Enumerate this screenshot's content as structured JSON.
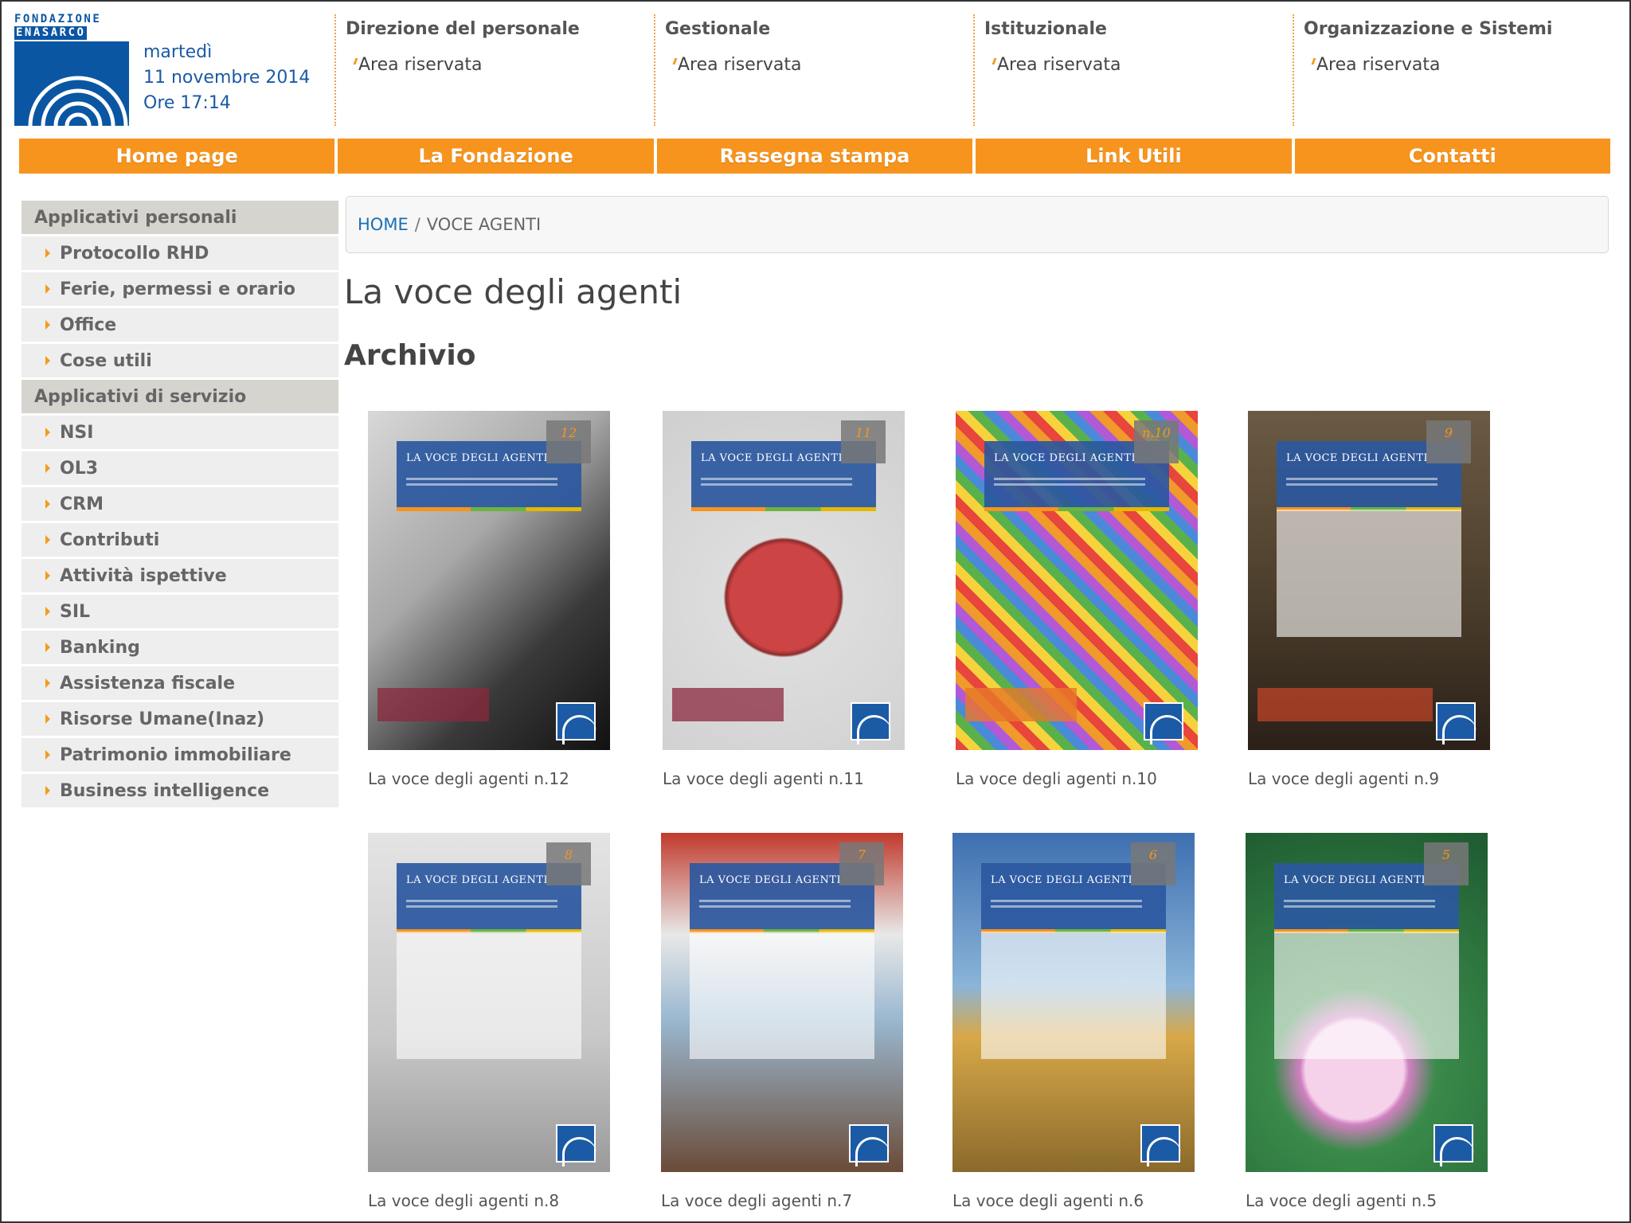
{
  "header": {
    "logo_line1": "FONDAZIONE",
    "logo_line2": "ENASARCO",
    "date_day": "martedì",
    "date_full": "11 novembre 2014",
    "time": "Ore 17:14"
  },
  "top_columns": [
    {
      "title": "Direzione del personale",
      "link": "Area riservata"
    },
    {
      "title": "Gestionale",
      "link": "Area riservata"
    },
    {
      "title": "Istituzionale",
      "link": "Area riservata"
    },
    {
      "title": "Organizzazione e Sistemi",
      "link": "Area riservata"
    }
  ],
  "nav": [
    "Home page",
    "La Fondazione",
    "Rassegna stampa",
    "Link Utili",
    "Contatti"
  ],
  "sidebar": {
    "section1": "Applicativi personali",
    "items1": [
      "Protocollo RHD",
      "Ferie, permessi e orario",
      "Office",
      "Cose utili"
    ],
    "section2": "Applicativi di servizio",
    "items2": [
      "NSI",
      "OL3",
      "CRM",
      "Contributi",
      "Attività ispettive",
      "SIL",
      "Banking",
      "Assistenza fiscale",
      "Risorse Umane(Inaz)",
      "Patrimonio immobiliare",
      "Business intelligence"
    ]
  },
  "breadcrumb": {
    "home": "HOME",
    "sep": "/",
    "current": "VOCE AGENTI"
  },
  "main": {
    "title": "La voce degli agenti",
    "subtitle": "Archivio",
    "issues": [
      {
        "caption": "La voce degli agenti n.12",
        "num": "12"
      },
      {
        "caption": "La voce degli agenti n.11",
        "num": "11"
      },
      {
        "caption": "La voce degli agenti n.10",
        "num": "n.10"
      },
      {
        "caption": "La voce degli agenti n.9",
        "num": "9"
      },
      {
        "caption": "La voce degli agenti n.8",
        "num": "8"
      },
      {
        "caption": "La voce degli agenti n.7",
        "num": "7"
      },
      {
        "caption": "La voce degli agenti n.6",
        "num": "6"
      },
      {
        "caption": "La voce degli agenti n.5",
        "num": "5"
      }
    ],
    "cover_masthead": "LA VOCE DEGLI AGENTI"
  },
  "colors": {
    "accent": "#f7941d",
    "brand_blue": "#0a56a3",
    "sidebar_head": "#d6d4ce"
  }
}
